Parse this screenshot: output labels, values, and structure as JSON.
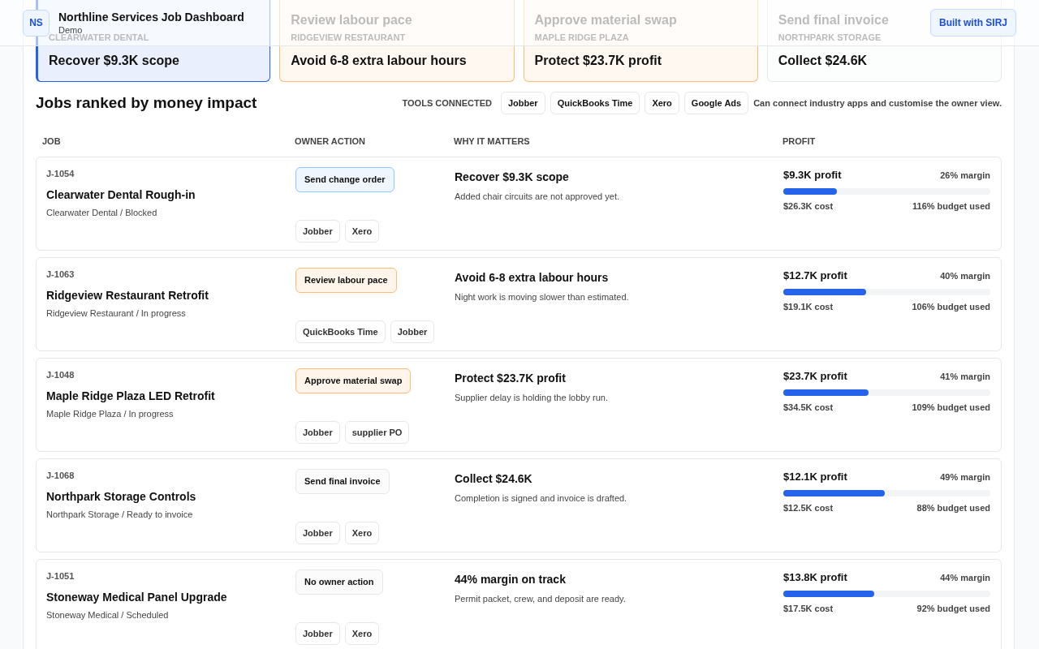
{
  "header": {
    "initials": "NS",
    "title": "Northline Services Job Dashboard",
    "subtitle": "Demo",
    "badge": "Built with SIRJ"
  },
  "cards": [
    {
      "color": "#2563eb",
      "client": "CLEARWATER DENTAL",
      "outcome": "Recover $9.3K scope"
    },
    {
      "color": "#fdba74",
      "title": "Review labour pace",
      "client": "RIDGEVIEW RESTAURANT",
      "outcome": "Avoid 6-8 extra labour hours"
    },
    {
      "color": "#fdba74",
      "title": "Approve material swap",
      "client": "MAPLE RIDGE PLAZA",
      "outcome": "Protect $23.7K profit"
    },
    {
      "color": "#e5e7eb",
      "title": "Send final invoice",
      "client": "NORTHPARK STORAGE",
      "outcome": "Collect $24.6K"
    }
  ],
  "section": {
    "title": "Jobs ranked by money impact",
    "tools_label": "TOOLS CONNECTED",
    "tools": [
      "Jobber",
      "QuickBooks Time",
      "Xero",
      "Google Ads"
    ],
    "tools_note": "Can connect industry apps and customise the owner view."
  },
  "columns": [
    "JOB",
    "OWNER ACTION",
    "WHY IT MATTERS",
    "PROFIT"
  ],
  "rows": [
    {
      "id": "J-1054",
      "name": "Clearwater Dental Rough-in",
      "meta": "Clearwater Dental / Blocked",
      "action": "Send change order",
      "color": "#93c5fd",
      "apps": [
        "Jobber",
        "Xero"
      ],
      "why": "Recover $9.3K scope",
      "detail": "Added chair circuits are not approved yet.",
      "profit": "$9.3K profit",
      "margin": "26% margin",
      "level": 0.26,
      "cost": "$26.3K cost",
      "budget": "116% budget used"
    },
    {
      "id": "J-1063",
      "name": "Ridgeview Restaurant Retrofit",
      "meta": "Ridgeview Restaurant / In progress",
      "action": "Review labour pace",
      "color": "#fdba74",
      "apps": [
        "QuickBooks Time",
        "Jobber"
      ],
      "why": "Avoid 6-8 extra labour hours",
      "detail": "Night work is moving slower than estimated.",
      "profit": "$12.7K profit",
      "margin": "40% margin",
      "level": 0.4,
      "cost": "$19.1K cost",
      "budget": "106% budget used"
    },
    {
      "id": "J-1048",
      "name": "Maple Ridge Plaza LED Retrofit",
      "meta": "Maple Ridge Plaza / In progress",
      "action": "Approve material swap",
      "color": "#fdba74",
      "apps": [
        "Jobber",
        "supplier PO"
      ],
      "why": "Protect $23.7K profit",
      "detail": "Supplier delay is holding the lobby run.",
      "profit": "$23.7K profit",
      "margin": "41% margin",
      "level": 0.41,
      "cost": "$34.5K cost",
      "budget": "109% budget used"
    },
    {
      "id": "J-1068",
      "name": "Northpark Storage Controls",
      "meta": "Northpark Storage / Ready to invoice",
      "action": "Send final invoice",
      "color": "#e5e7eb",
      "apps": [
        "Jobber",
        "Xero"
      ],
      "why": "Collect $24.6K",
      "detail": "Completion is signed and invoice is drafted.",
      "profit": "$12.1K profit",
      "margin": "49% margin",
      "level": 0.49,
      "cost": "$12.5K cost",
      "budget": "88% budget used"
    },
    {
      "id": "J-1051",
      "name": "Stoneway Medical Panel Upgrade",
      "meta": "Stoneway Medical / Scheduled",
      "action": "No owner action",
      "color": "#e5e7eb",
      "apps": [
        "Jobber",
        "Xero"
      ],
      "why": "44% margin on track",
      "detail": "Permit packet, crew, and deposit are ready.",
      "profit": "$13.8K profit",
      "margin": "44% margin",
      "level": 0.44,
      "cost": "$17.5K cost",
      "budget": "92% budget used"
    }
  ]
}
